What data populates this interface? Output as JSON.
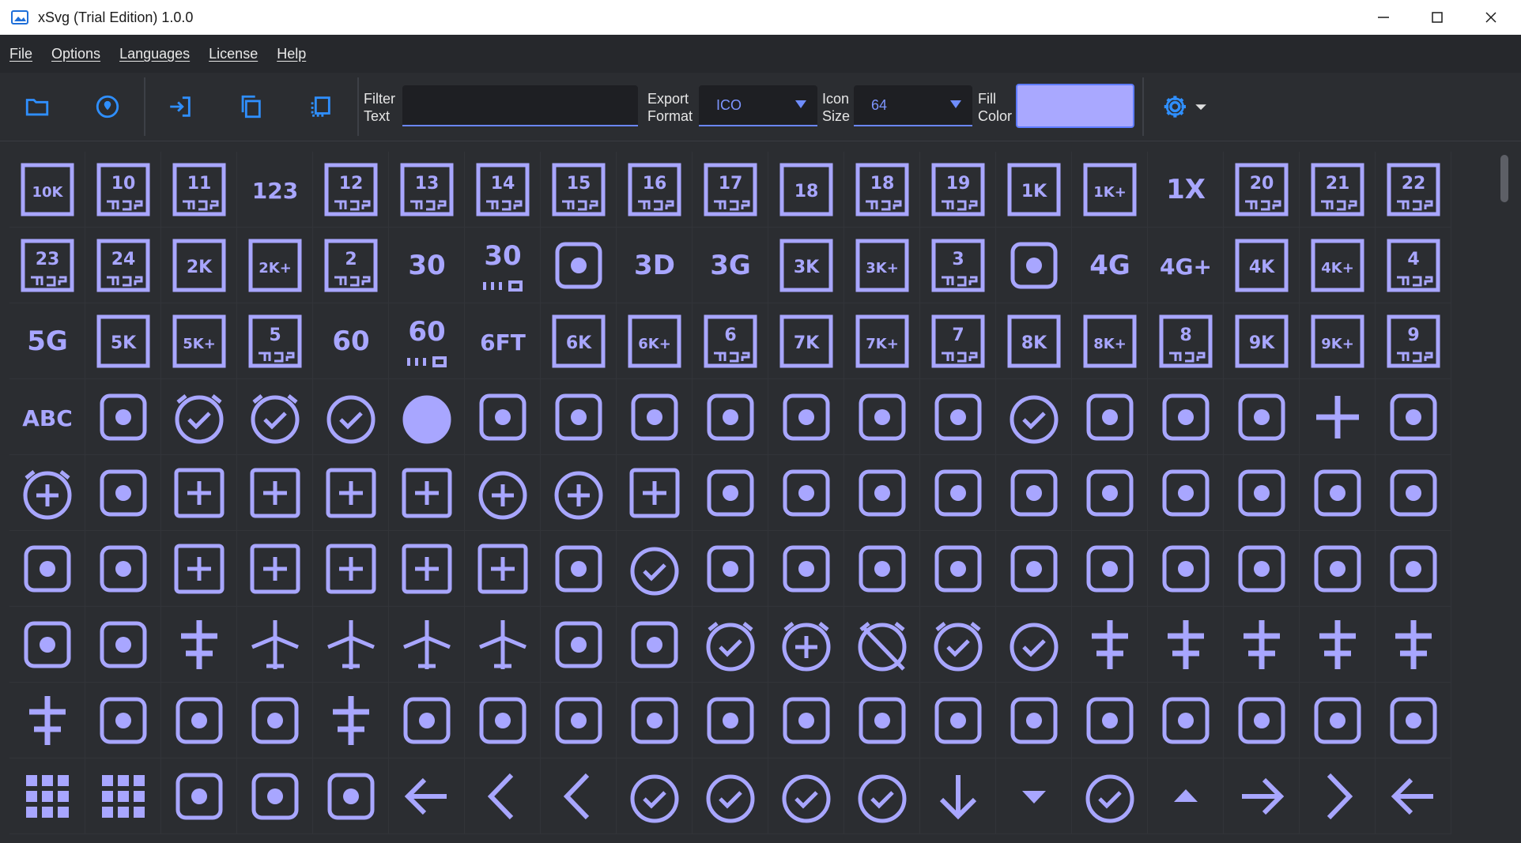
{
  "window": {
    "title": "xSvg (Trial Edition)  1.0.0",
    "app_icon": "image-icon",
    "controls": [
      "minimize-icon",
      "maximize-icon",
      "close-icon"
    ]
  },
  "menu": [
    "File",
    "Options",
    "Languages",
    "License",
    "Help"
  ],
  "toolbar": {
    "buttons": [
      "folder-icon",
      "location-icon",
      "import-icon",
      "copy-icon",
      "copy-dashed-icon"
    ],
    "filter_label": "Filter\nText",
    "filter_value": "",
    "export_label": "Export\nFormat",
    "export_value": "ICO",
    "size_label": "Icon\nSize",
    "size_value": "64",
    "fill_label": "Fill\nColor",
    "fill_color": "#a9a8ff",
    "settings_icon": "gear-icon"
  },
  "colors": {
    "icon_fill": "#a8a6ff",
    "accent": "#6a86ff",
    "background": "#2b2d31"
  },
  "icons": [
    {
      "name": "10k-icon",
      "text": "10K"
    },
    {
      "name": "10mp-icon",
      "text": "10"
    },
    {
      "name": "11mp-icon",
      "text": "11"
    },
    {
      "name": "123-icon",
      "text": "123"
    },
    {
      "name": "12mp-icon",
      "text": "12"
    },
    {
      "name": "13mp-icon",
      "text": "13"
    },
    {
      "name": "14mp-icon",
      "text": "14"
    },
    {
      "name": "15mp-icon",
      "text": "15"
    },
    {
      "name": "16mp-icon",
      "text": "16"
    },
    {
      "name": "17mp-icon",
      "text": "17"
    },
    {
      "name": "18-up-rating-icon",
      "text": "18"
    },
    {
      "name": "18mp-icon",
      "text": "18"
    },
    {
      "name": "19mp-icon",
      "text": "19"
    },
    {
      "name": "1k-icon",
      "text": "1K"
    },
    {
      "name": "1k-plus-icon",
      "text": "1K+"
    },
    {
      "name": "1x-mobiledata-icon",
      "text": "1X"
    },
    {
      "name": "20mp-icon",
      "text": "20"
    },
    {
      "name": "21mp-icon",
      "text": "21"
    },
    {
      "name": "22mp-icon",
      "text": "22"
    },
    {
      "name": "23mp-icon",
      "text": "23"
    },
    {
      "name": "24mp-icon",
      "text": "24"
    },
    {
      "name": "2k-icon",
      "text": "2K"
    },
    {
      "name": "2k-plus-icon",
      "text": "2K+"
    },
    {
      "name": "2mp-icon",
      "text": "2"
    },
    {
      "name": "30fps-icon",
      "text": "30"
    },
    {
      "name": "30fps-select-icon",
      "text": "30"
    },
    {
      "name": "360-icon",
      "text": ""
    },
    {
      "name": "3d-rotation-icon",
      "text": "3D"
    },
    {
      "name": "3g-mobiledata-icon",
      "text": "3G"
    },
    {
      "name": "3k-icon",
      "text": "3K"
    },
    {
      "name": "3k-plus-icon",
      "text": "3K+"
    },
    {
      "name": "3mp-icon",
      "text": "3"
    },
    {
      "name": "3p-icon",
      "text": ""
    },
    {
      "name": "4g-mobiledata-icon",
      "text": "4G"
    },
    {
      "name": "4g-plus-mobiledata-icon",
      "text": "4G+"
    },
    {
      "name": "4k-icon",
      "text": "4K"
    },
    {
      "name": "4k-plus-icon",
      "text": "4K+"
    },
    {
      "name": "4mp-icon",
      "text": "4"
    },
    {
      "name": "5g-icon",
      "text": "5G"
    },
    {
      "name": "5k-icon",
      "text": "5K"
    },
    {
      "name": "5k-plus-icon",
      "text": "5K+"
    },
    {
      "name": "5mp-icon",
      "text": "5"
    },
    {
      "name": "60fps-icon",
      "text": "60"
    },
    {
      "name": "60fps-select-icon",
      "text": "60"
    },
    {
      "name": "6-ft-apart-icon",
      "text": "6FT"
    },
    {
      "name": "6k-icon",
      "text": "6K"
    },
    {
      "name": "6k-plus-icon",
      "text": "6K+"
    },
    {
      "name": "6mp-icon",
      "text": "6"
    },
    {
      "name": "7k-icon",
      "text": "7K"
    },
    {
      "name": "7k-plus-icon",
      "text": "7K+"
    },
    {
      "name": "7mp-icon",
      "text": "7"
    },
    {
      "name": "8k-icon",
      "text": "8K"
    },
    {
      "name": "8k-plus-icon",
      "text": "8K+"
    },
    {
      "name": "8mp-icon",
      "text": "8"
    },
    {
      "name": "9k-icon",
      "text": "9K"
    },
    {
      "name": "9k-plus-icon",
      "text": "9K+"
    },
    {
      "name": "9mp-icon",
      "text": "9"
    },
    {
      "name": "abc-icon",
      "text": "ABC"
    },
    {
      "name": "ac-unit-icon",
      "text": ""
    },
    {
      "name": "access-alarm-icon",
      "text": ""
    },
    {
      "name": "access-alarms-icon",
      "text": ""
    },
    {
      "name": "access-time-icon",
      "text": ""
    },
    {
      "name": "access-time-filled-icon",
      "text": ""
    },
    {
      "name": "accessibility-icon",
      "text": ""
    },
    {
      "name": "accessibility-new-icon",
      "text": ""
    },
    {
      "name": "accessible-icon",
      "text": ""
    },
    {
      "name": "accessible-forward-icon",
      "text": ""
    },
    {
      "name": "account-balance-icon",
      "text": ""
    },
    {
      "name": "account-balance-wallet-icon",
      "text": ""
    },
    {
      "name": "account-box-icon",
      "text": ""
    },
    {
      "name": "account-circle-icon",
      "text": ""
    },
    {
      "name": "account-tree-icon",
      "text": ""
    },
    {
      "name": "ad-units-icon",
      "text": ""
    },
    {
      "name": "adb-icon",
      "text": ""
    },
    {
      "name": "add-icon",
      "text": ""
    },
    {
      "name": "add-a-photo-icon",
      "text": ""
    },
    {
      "name": "add-alarm-icon",
      "text": ""
    },
    {
      "name": "add-alert-icon",
      "text": ""
    },
    {
      "name": "add-box-icon",
      "text": ""
    },
    {
      "name": "add-business-icon",
      "text": ""
    },
    {
      "name": "add-card-icon",
      "text": ""
    },
    {
      "name": "add-chart-icon",
      "text": ""
    },
    {
      "name": "add-circle-icon",
      "text": ""
    },
    {
      "name": "add-circle-outline-icon",
      "text": ""
    },
    {
      "name": "add-comment-icon",
      "text": ""
    },
    {
      "name": "add-home-icon",
      "text": ""
    },
    {
      "name": "add-home-work-icon",
      "text": ""
    },
    {
      "name": "add-ic-call-icon",
      "text": ""
    },
    {
      "name": "add-link-icon",
      "text": ""
    },
    {
      "name": "add-location-icon",
      "text": ""
    },
    {
      "name": "add-location-alt-icon",
      "text": ""
    },
    {
      "name": "add-moderator-icon",
      "text": ""
    },
    {
      "name": "add-photo-alternate-icon",
      "text": ""
    },
    {
      "name": "add-reaction-icon",
      "text": ""
    },
    {
      "name": "add-road-icon",
      "text": ""
    },
    {
      "name": "add-shopping-cart-icon",
      "text": ""
    },
    {
      "name": "add-task-icon",
      "text": ""
    },
    {
      "name": "add-to-drive-icon",
      "text": ""
    },
    {
      "name": "add-to-home-screen-icon",
      "text": ""
    },
    {
      "name": "add-to-photos-icon",
      "text": ""
    },
    {
      "name": "add-to-queue-icon",
      "text": ""
    },
    {
      "name": "addchart-icon",
      "text": ""
    },
    {
      "name": "adf-scanner-icon",
      "text": ""
    },
    {
      "name": "adjust-icon",
      "text": ""
    },
    {
      "name": "admin-panel-settings-icon",
      "text": ""
    },
    {
      "name": "ads-click-icon",
      "text": ""
    },
    {
      "name": "agriculture-icon",
      "text": ""
    },
    {
      "name": "air-icon",
      "text": ""
    },
    {
      "name": "airline-seat-flat-icon",
      "text": ""
    },
    {
      "name": "airline-seat-flat-angled-icon",
      "text": ""
    },
    {
      "name": "airline-seat-individual-suite-icon",
      "text": ""
    },
    {
      "name": "airline-seat-legroom-extra-icon",
      "text": ""
    },
    {
      "name": "airline-seat-legroom-normal-icon",
      "text": ""
    },
    {
      "name": "airline-seat-legroom-reduced-icon",
      "text": ""
    },
    {
      "name": "airline-seat-recline-extra-icon",
      "text": ""
    },
    {
      "name": "airline-seat-recline-normal-icon",
      "text": ""
    },
    {
      "name": "airline-stops-icon",
      "text": ""
    },
    {
      "name": "airlines-icon",
      "text": ""
    },
    {
      "name": "airplane-ticket-icon",
      "text": ""
    },
    {
      "name": "airplanemode-active-icon",
      "text": ""
    },
    {
      "name": "airplanemode-inactive-icon",
      "text": ""
    },
    {
      "name": "airplay-icon",
      "text": ""
    },
    {
      "name": "airport-shuttle-icon",
      "text": ""
    },
    {
      "name": "alarm-icon",
      "text": ""
    },
    {
      "name": "alarm-add-icon",
      "text": ""
    },
    {
      "name": "alarm-off-icon",
      "text": ""
    },
    {
      "name": "alarm-on-icon",
      "text": ""
    },
    {
      "name": "album-icon",
      "text": ""
    },
    {
      "name": "align-horizontal-center-icon",
      "text": ""
    },
    {
      "name": "align-horizontal-left-icon",
      "text": ""
    },
    {
      "name": "align-horizontal-right-icon",
      "text": ""
    },
    {
      "name": "align-vertical-bottom-icon",
      "text": ""
    },
    {
      "name": "align-vertical-center-icon",
      "text": ""
    },
    {
      "name": "align-vertical-top-icon",
      "text": ""
    },
    {
      "name": "all-inbox-icon",
      "text": ""
    },
    {
      "name": "all-inclusive-icon",
      "text": ""
    },
    {
      "name": "all-out-icon",
      "text": ""
    },
    {
      "name": "alt-route-icon",
      "text": ""
    },
    {
      "name": "alternate-email-icon",
      "text": ""
    },
    {
      "name": "analytics-icon",
      "text": ""
    },
    {
      "name": "anchor-icon",
      "text": ""
    },
    {
      "name": "android-icon",
      "text": ""
    },
    {
      "name": "animation-icon",
      "text": ""
    },
    {
      "name": "announcement-icon",
      "text": ""
    },
    {
      "name": "aod-icon",
      "text": ""
    },
    {
      "name": "apartment-icon",
      "text": ""
    },
    {
      "name": "api-icon",
      "text": ""
    },
    {
      "name": "app-blocking-icon",
      "text": ""
    },
    {
      "name": "app-registration-icon",
      "text": ""
    },
    {
      "name": "app-settings-alt-icon",
      "text": ""
    },
    {
      "name": "app-shortcut-icon",
      "text": ""
    },
    {
      "name": "approval-icon",
      "text": ""
    },
    {
      "name": "apps-icon",
      "text": ""
    },
    {
      "name": "apps-outage-icon",
      "text": ""
    },
    {
      "name": "architecture-icon",
      "text": ""
    },
    {
      "name": "archive-icon",
      "text": ""
    },
    {
      "name": "area-chart-icon",
      "text": ""
    },
    {
      "name": "arrow-back-icon",
      "text": ""
    },
    {
      "name": "arrow-back-ios-icon",
      "text": ""
    },
    {
      "name": "arrow-back-ios-new-icon",
      "text": ""
    },
    {
      "name": "arrow-circle-down-icon",
      "text": ""
    },
    {
      "name": "arrow-circle-left-icon",
      "text": ""
    },
    {
      "name": "arrow-circle-right-icon",
      "text": ""
    },
    {
      "name": "arrow-circle-up-icon",
      "text": ""
    },
    {
      "name": "arrow-downward-icon",
      "text": ""
    },
    {
      "name": "arrow-drop-down-icon",
      "text": ""
    },
    {
      "name": "arrow-drop-down-circle-icon",
      "text": ""
    },
    {
      "name": "arrow-drop-up-icon",
      "text": ""
    },
    {
      "name": "arrow-forward-icon",
      "text": ""
    },
    {
      "name": "arrow-forward-ios-icon",
      "text": ""
    },
    {
      "name": "arrow-left-icon",
      "text": ""
    }
  ]
}
